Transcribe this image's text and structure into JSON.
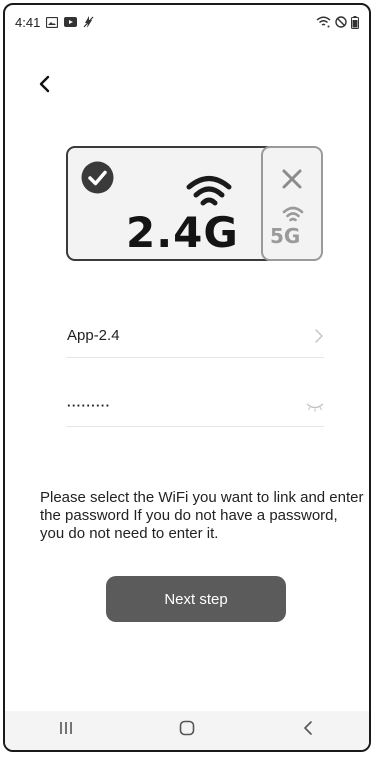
{
  "status_bar": {
    "time": "4:41",
    "left_icons": [
      "gallery-icon",
      "youtube-icon",
      "no-sync-icon"
    ],
    "right_icons": [
      "wifi-icon",
      "do-not-disturb-icon",
      "battery-icon"
    ]
  },
  "header": {
    "back_icon": "chevron-left-icon"
  },
  "bands": {
    "band_24": {
      "label": "2.4G",
      "selected": true,
      "status_icon": "check-circle-icon"
    },
    "band_5": {
      "label": "5G",
      "selected": false,
      "status_icon": "close-icon"
    }
  },
  "form": {
    "ssid_value": "App-2.4",
    "ssid_icon": "chevron-right-icon",
    "password_value": "·········",
    "password_icon": "eye-closed-icon"
  },
  "hint_text": "Please select the WiFi you want to link and enter the password If you do not have a password, you do not need to enter it.",
  "next_button_label": "Next step",
  "nav_bar": {
    "icons": [
      "recents-icon",
      "home-icon",
      "back-icon"
    ]
  },
  "colors": {
    "button_bg": "#5b5b5b",
    "card_bg": "#f3f3f3",
    "selected_border": "#3a3a3a",
    "unselected_border": "#9a9a9a"
  }
}
